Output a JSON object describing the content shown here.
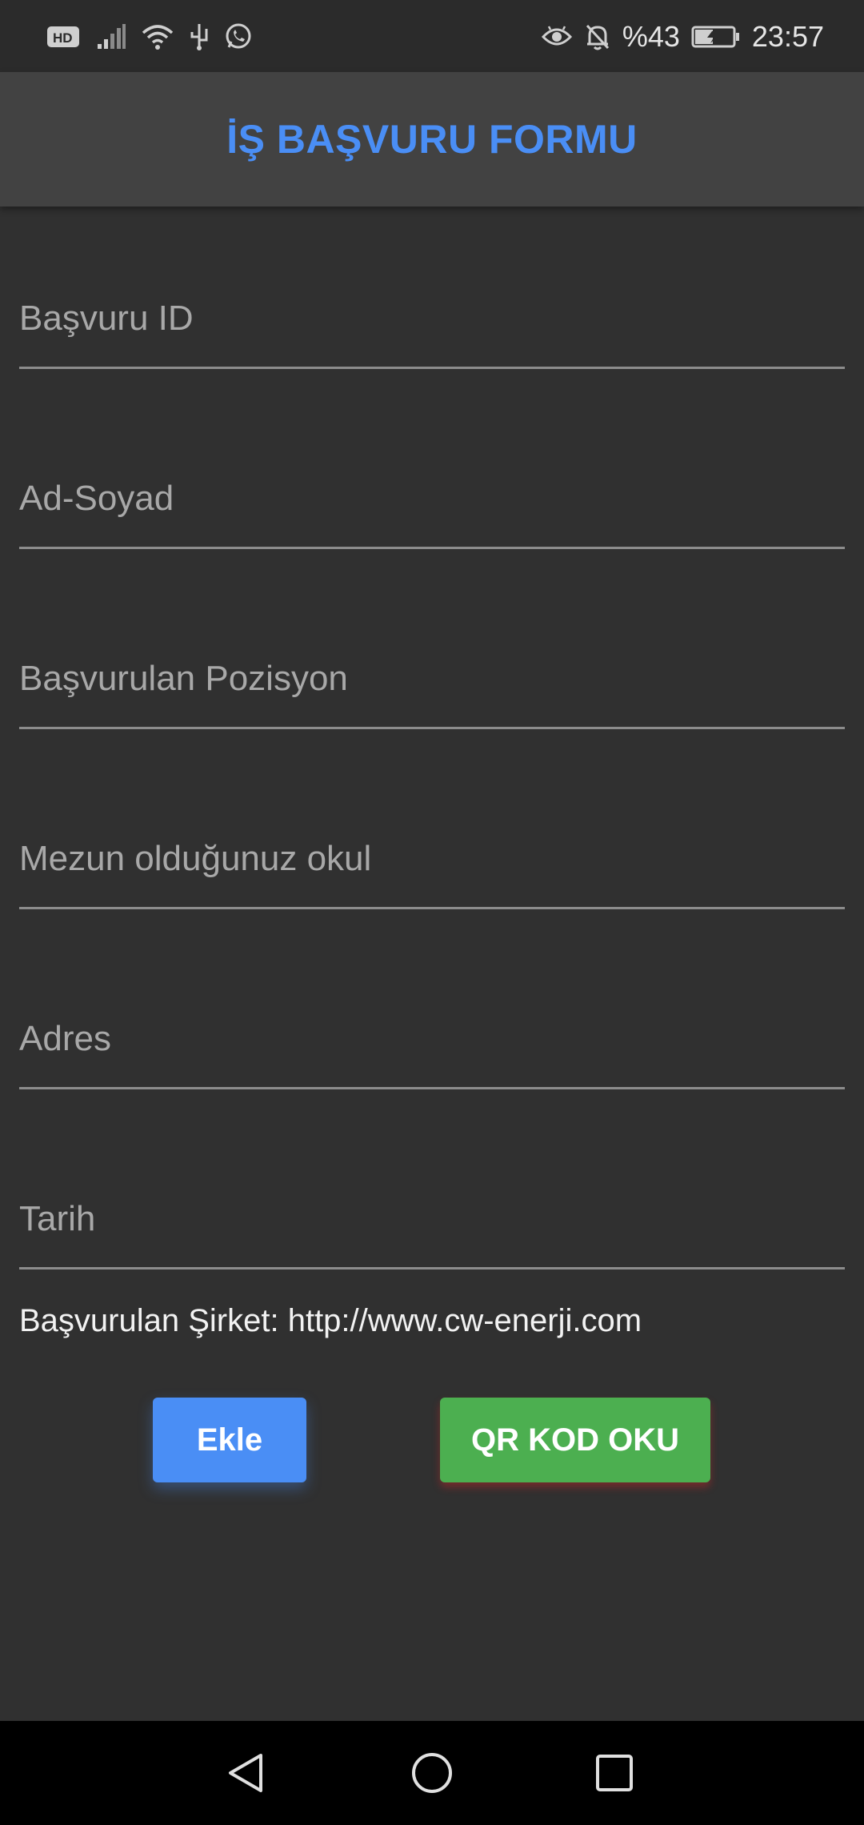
{
  "status_bar": {
    "hd_label": "HD",
    "battery_percent": "%43",
    "time": "23:57",
    "icons": [
      "hd-icon",
      "signal-icon",
      "wifi-icon",
      "usb-icon",
      "whatsapp-icon",
      "eye-icon",
      "bell-off-icon",
      "battery-charging-icon"
    ]
  },
  "app_bar": {
    "title": "İŞ BAŞVURU FORMU"
  },
  "form": {
    "fields": [
      {
        "name": "basvuru-id",
        "value": "",
        "placeholder": "Başvuru ID"
      },
      {
        "name": "ad-soyad",
        "value": "",
        "placeholder": "Ad-Soyad"
      },
      {
        "name": "basvurulan-pozisyon",
        "value": "",
        "placeholder": "Başvurulan Pozisyon"
      },
      {
        "name": "mezun-okul",
        "value": "",
        "placeholder": "Mezun olduğunuz okul"
      },
      {
        "name": "adres",
        "value": "",
        "placeholder": "Adres"
      },
      {
        "name": "tarih",
        "value": "",
        "placeholder": "Tarih"
      }
    ],
    "company_text": "Başvurulan Şirket: http://www.cw-enerji.com"
  },
  "buttons": {
    "add_label": "Ekle",
    "qr_label": "QR KOD OKU"
  },
  "nav_bar": {
    "icons": [
      "back-triangle-icon",
      "home-circle-icon",
      "recents-square-icon"
    ]
  },
  "colors": {
    "accent_blue": "#4a8ef5",
    "accent_green": "#4caf50",
    "background": "#303030",
    "app_bar": "#424242"
  }
}
